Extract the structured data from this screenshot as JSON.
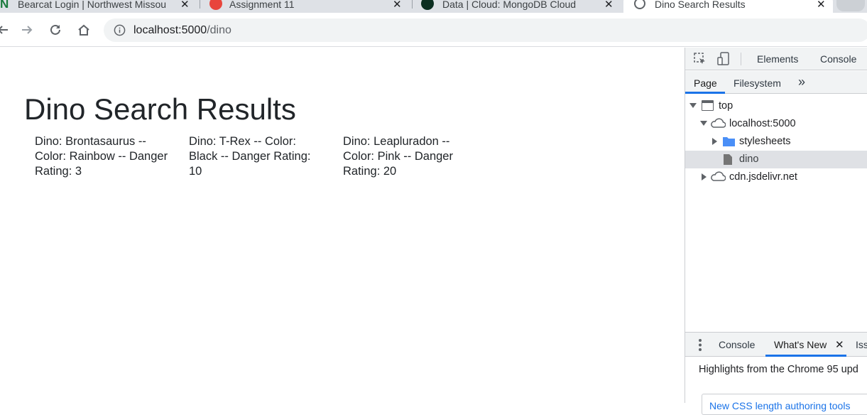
{
  "browser": {
    "tabs": [
      {
        "title": "Bearcat Login | Northwest Missou"
      },
      {
        "title": "Assignment 11"
      },
      {
        "title": "Data | Cloud: MongoDB Cloud"
      },
      {
        "title": "Dino Search Results"
      }
    ],
    "url_host": "localhost:5000",
    "url_path": "/dino"
  },
  "page": {
    "heading": "Dino Search Results",
    "dinos": [
      {
        "text": "Dino: Brontasaurus -- Color: Rainbow -- Danger Rating: 3"
      },
      {
        "text": "Dino: T-Rex -- Color: Black -- Danger Rating: 10"
      },
      {
        "text": "Dino: Leapluradon -- Color: Pink -- Danger Rating: 20"
      }
    ]
  },
  "devtools": {
    "main_tabs": {
      "elements": "Elements",
      "console": "Console"
    },
    "sub_tabs": {
      "page": "Page",
      "filesystem": "Filesystem",
      "more": "»"
    },
    "tree": {
      "top": "top",
      "host": "localhost:5000",
      "stylesheets": "stylesheets",
      "dino": "dino",
      "cdn": "cdn.jsdelivr.net"
    },
    "drawer": {
      "console": "Console",
      "whats_new": "What's New",
      "issues": "Iss",
      "highlights": "Highlights from the Chrome 95 upd",
      "card_text": "New CSS length authoring tools"
    }
  },
  "colors": {
    "accent": "#1a73e8",
    "folder": "#4a8ff7"
  }
}
